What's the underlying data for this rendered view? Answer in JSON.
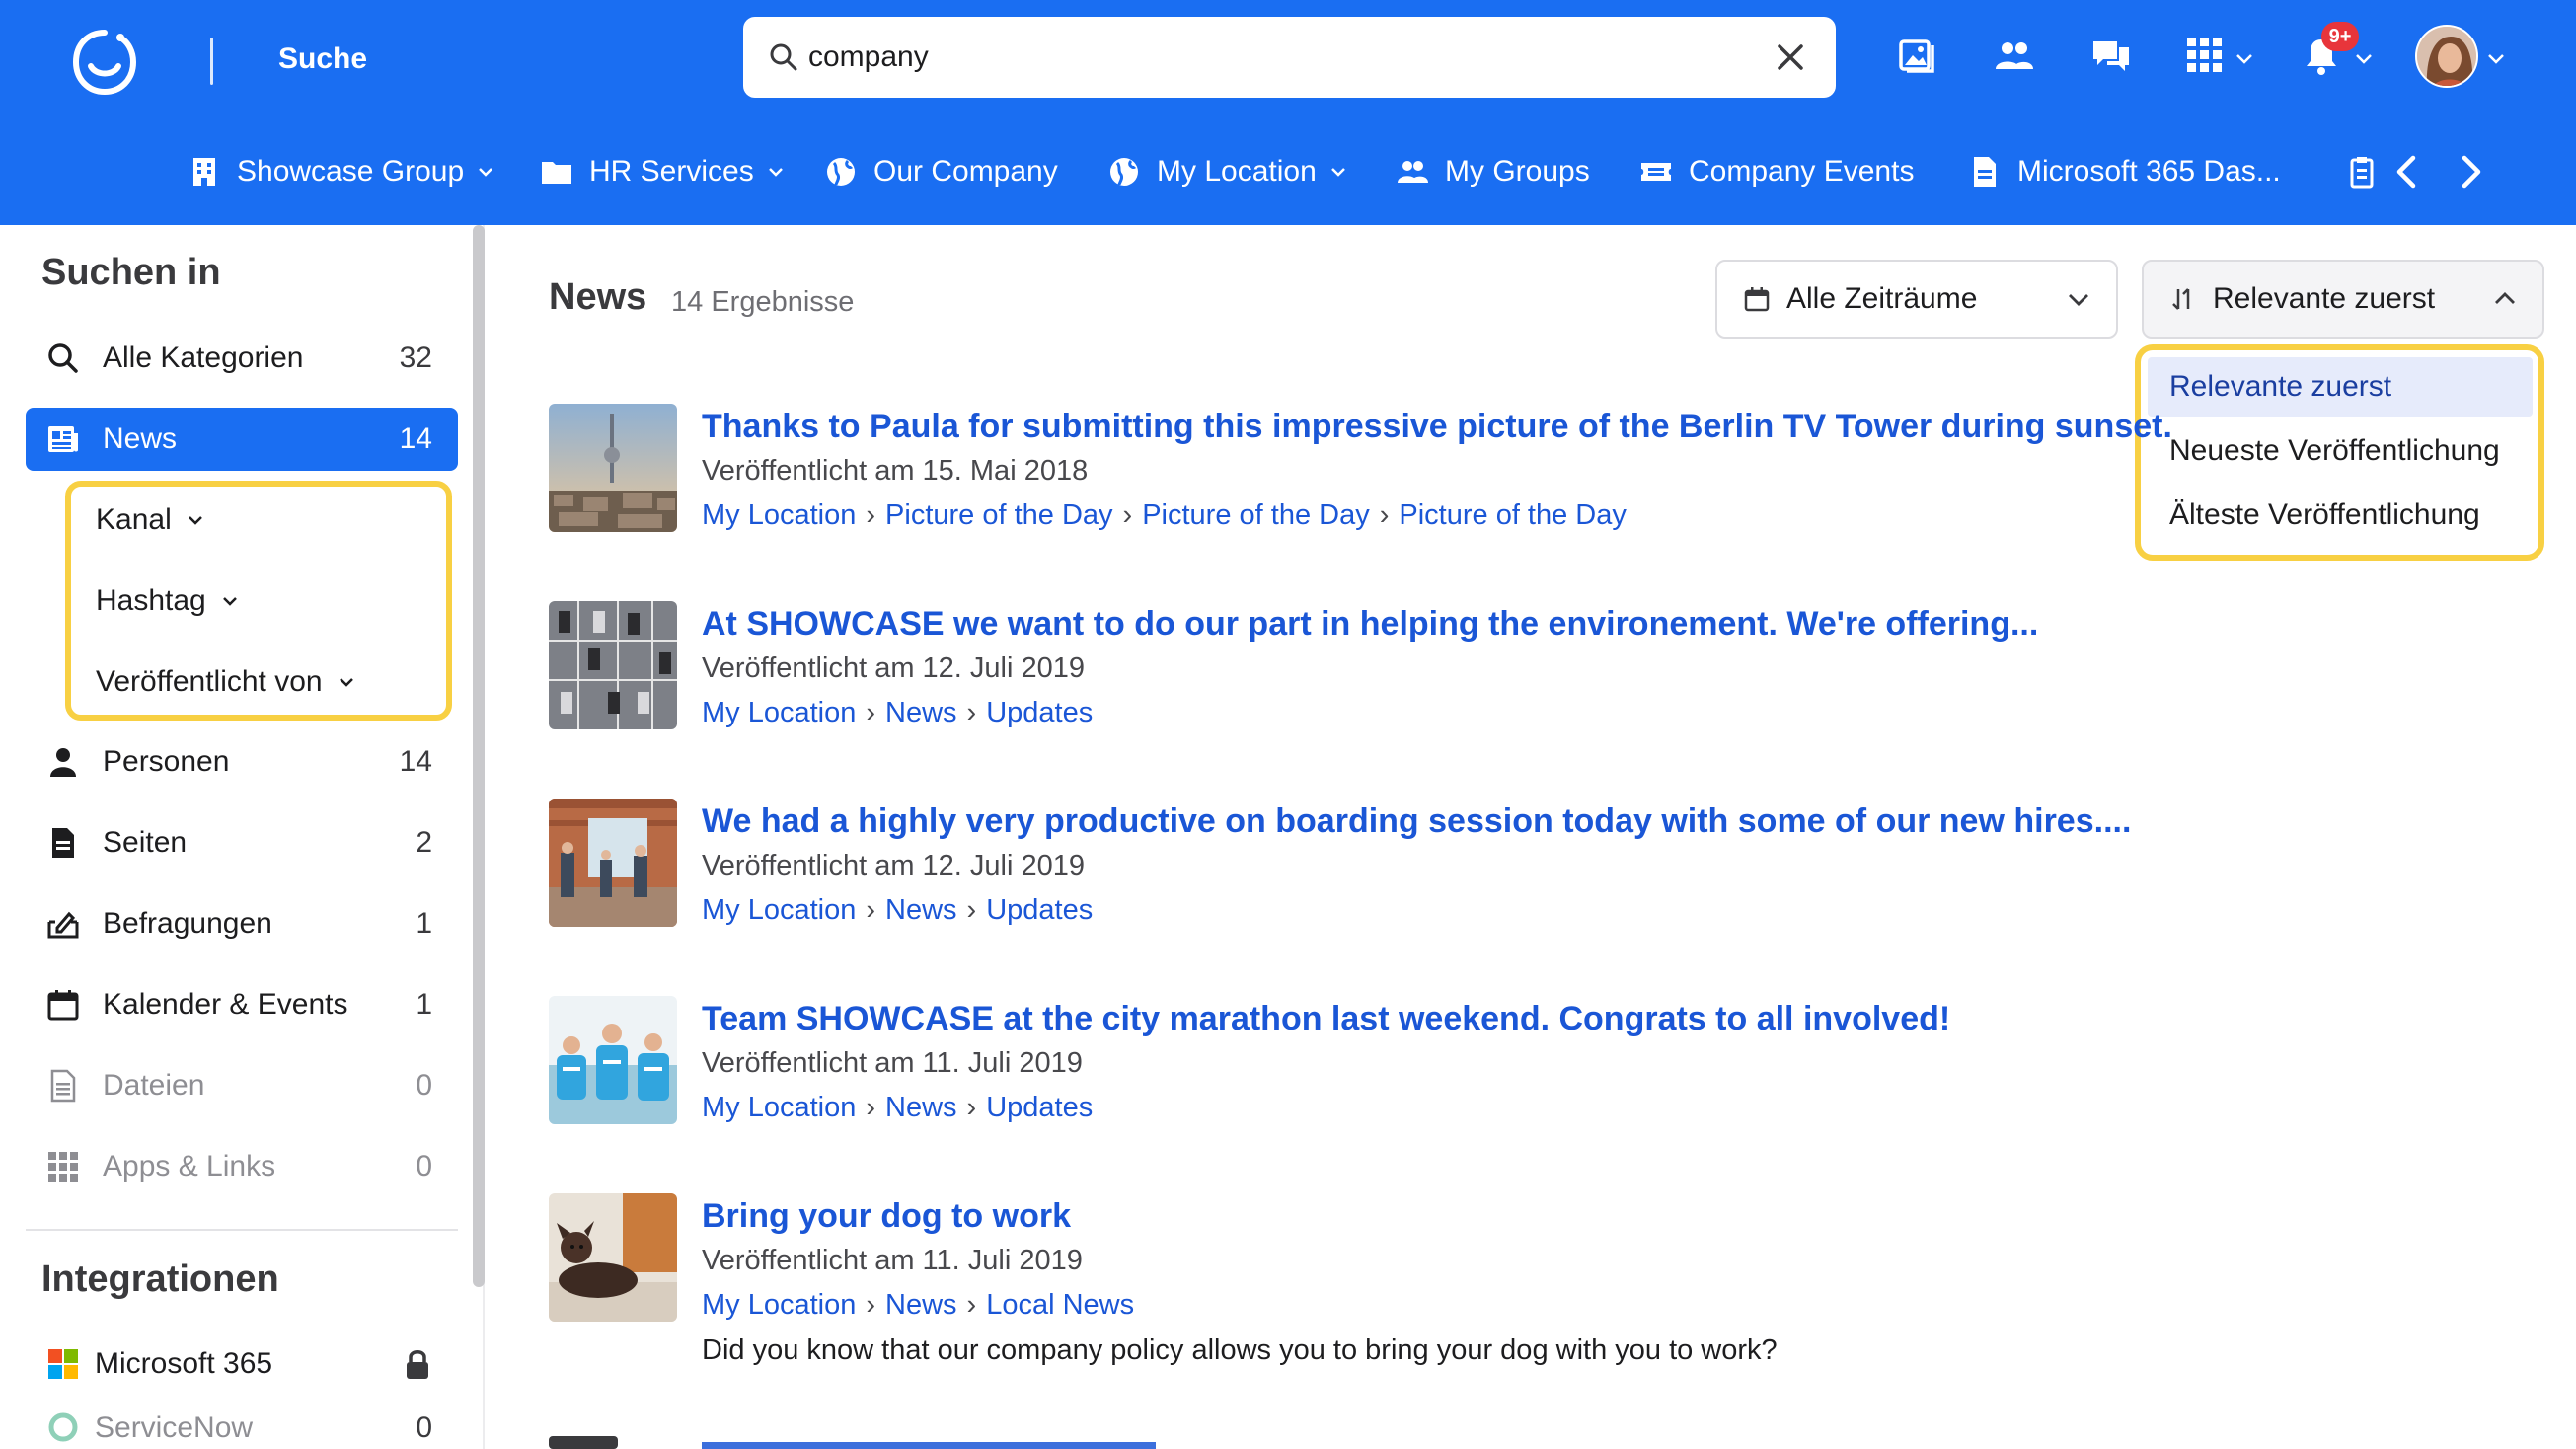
{
  "header": {
    "title": "Suche",
    "search_value": "company",
    "notification_badge": "9+"
  },
  "nav": {
    "items": [
      {
        "label": "Showcase Group",
        "icon": "building-icon",
        "dropdown": true
      },
      {
        "label": "HR Services",
        "icon": "folder-icon",
        "dropdown": true
      },
      {
        "label": "Our Company",
        "icon": "globe-icon",
        "dropdown": false
      },
      {
        "label": "My Location",
        "icon": "globe-icon",
        "dropdown": true
      },
      {
        "label": "My Groups",
        "icon": "users-icon",
        "dropdown": false
      },
      {
        "label": "Company Events",
        "icon": "ticket-icon",
        "dropdown": false
      },
      {
        "label": "Microsoft 365 Das...",
        "icon": "document-icon",
        "dropdown": false
      }
    ]
  },
  "sidebar": {
    "heading": "Suchen in",
    "categories": [
      {
        "label": "Alle Kategorien",
        "count": "32",
        "icon": "search-icon"
      },
      {
        "label": "News",
        "count": "14",
        "icon": "news-icon",
        "active": true
      },
      {
        "label": "Personen",
        "count": "14",
        "icon": "person-icon"
      },
      {
        "label": "Seiten",
        "count": "2",
        "icon": "page-icon"
      },
      {
        "label": "Befragungen",
        "count": "1",
        "icon": "survey-icon"
      },
      {
        "label": "Kalender & Events",
        "count": "1",
        "icon": "calendar-icon"
      },
      {
        "label": "Dateien",
        "count": "0",
        "icon": "file-icon",
        "muted": true
      },
      {
        "label": "Apps & Links",
        "count": "0",
        "icon": "apps-icon",
        "muted": true
      }
    ],
    "filters": [
      "Kanal",
      "Hashtag",
      "Veröffentlicht von"
    ],
    "integrations_heading": "Integrationen",
    "integrations": [
      {
        "label": "Microsoft 365",
        "status": "locked"
      },
      {
        "label": "ServiceNow",
        "count": "0"
      }
    ]
  },
  "main": {
    "title": "News",
    "count": "14 Ergebnisse",
    "time_filter": "Alle Zeiträume",
    "sort_label": "Relevante zuerst",
    "sort_options": [
      "Relevante zuerst",
      "Neueste Veröffentlichung",
      "Älteste Veröffentlichung"
    ],
    "results": [
      {
        "title": "Thanks to Paula for submitting this impressive picture of the Berlin TV Tower during sunset.",
        "date": "Veröffentlicht am 15. Mai 2018",
        "path": [
          "My Location",
          "Picture of the Day",
          "Picture of the Day",
          "Picture of the Day"
        ],
        "thumb": "tv-tower"
      },
      {
        "title": "At SHOWCASE we want to do our part in helping the environement. We're offering...",
        "date": "Veröffentlicht am 12. Juli 2019",
        "path": [
          "My Location",
          "News",
          "Updates"
        ],
        "thumb": "parking-lot"
      },
      {
        "title": "We had a highly very productive on boarding session today with some of our new hires....",
        "date": "Veröffentlicht am 12. Juli 2019",
        "path": [
          "My Location",
          "News",
          "Updates"
        ],
        "thumb": "office"
      },
      {
        "title": "Team SHOWCASE at the city marathon last weekend. Congrats to all involved!",
        "date": "Veröffentlicht am 11. Juli 2019",
        "path": [
          "My Location",
          "News",
          "Updates"
        ],
        "thumb": "marathon"
      },
      {
        "title": "Bring your dog to work",
        "date": "Veröffentlicht am 11. Juli 2019",
        "path": [
          "My Location",
          "News",
          "Local News"
        ],
        "description": "Did you know that our company policy allows you to bring your dog with you to work?",
        "thumb": "dog"
      }
    ]
  },
  "colors": {
    "brand_blue": "#1a6ef2",
    "link_blue": "#1a56d6",
    "highlight_yellow": "#f8d043",
    "selected_option_bg": "#e6ebfb"
  }
}
